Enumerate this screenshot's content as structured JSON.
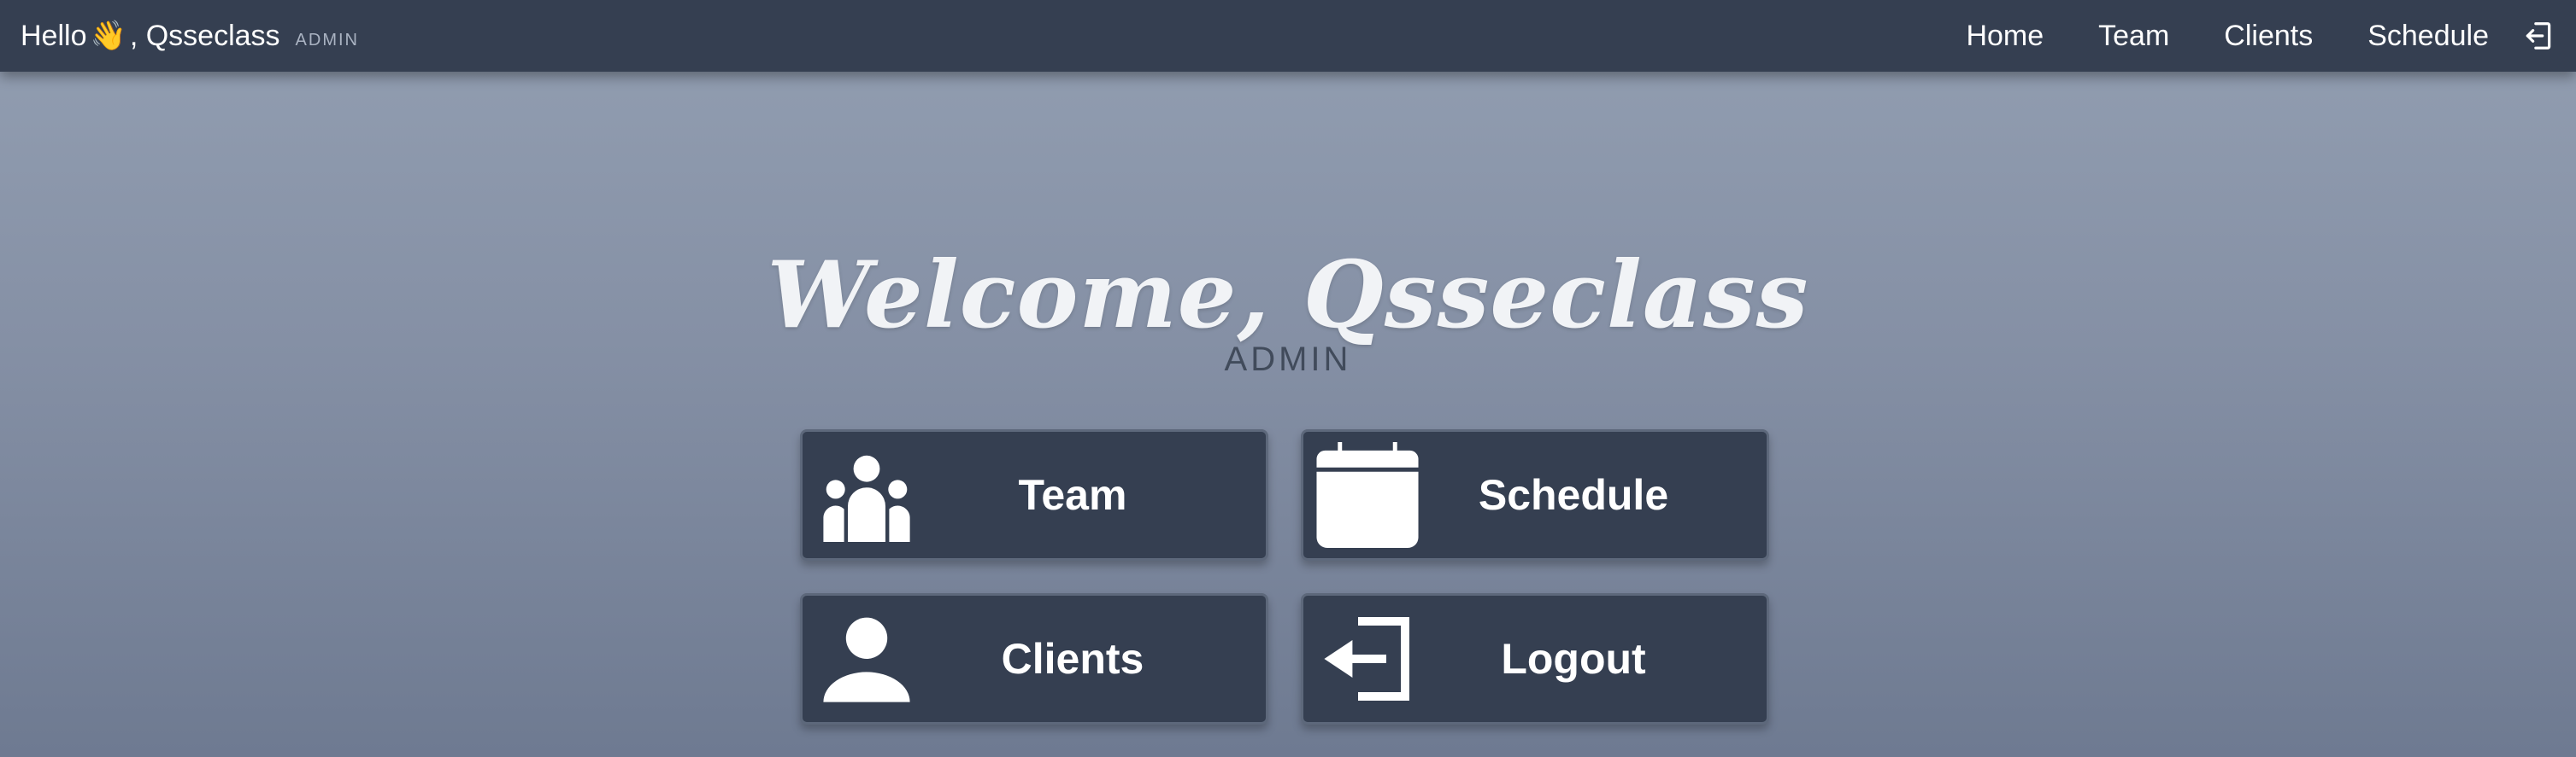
{
  "topbar": {
    "greeting_prefix": "Hello",
    "wave_emoji": "👋",
    "greeting_name": ", Qsseclass",
    "role": "ADMIN",
    "nav": [
      {
        "label": "Home"
      },
      {
        "label": "Team"
      },
      {
        "label": "Clients"
      },
      {
        "label": "Schedule"
      }
    ],
    "logout_icon": "logout-icon"
  },
  "hero": {
    "welcome": "Welcome, Qsseclass",
    "role": "ADMIN"
  },
  "tiles": [
    {
      "label": "Team",
      "icon": "team-icon"
    },
    {
      "label": "Schedule",
      "icon": "calendar-icon"
    },
    {
      "label": "Clients",
      "icon": "user-icon"
    },
    {
      "label": "Logout",
      "icon": "logout-icon"
    }
  ],
  "colors": {
    "bar": "#353f51",
    "tile": "#353f51",
    "text": "#ffffff",
    "subrole": "#414b5b"
  }
}
